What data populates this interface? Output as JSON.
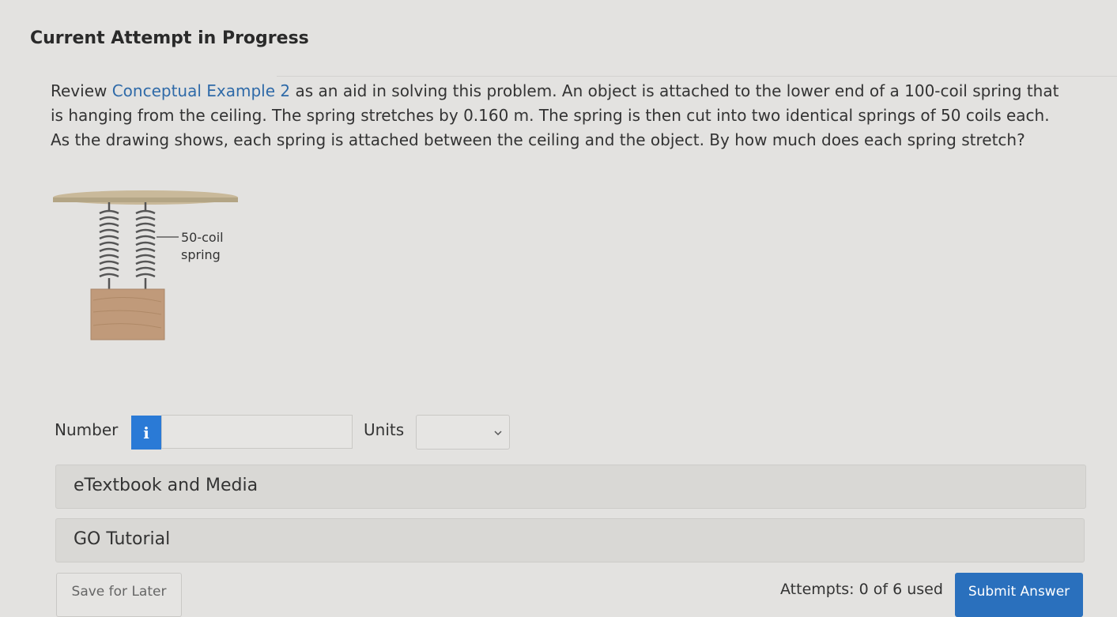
{
  "header": {
    "title": "Current Attempt in Progress"
  },
  "question": {
    "lead": "Review ",
    "link_text": "Conceptual Example 2",
    "text": " as an aid in solving this problem. An object is attached to the lower end of a 100-coil spring that is hanging from the ceiling. The spring stretches by 0.160 m. The spring is then cut into two identical springs of 50 coils each. As the drawing shows, each spring is attached between the ceiling and the object. By how much does each spring stretch?"
  },
  "figure": {
    "label_line1": "50-coil",
    "label_line2": "spring"
  },
  "answer": {
    "number_label": "Number",
    "info_icon_glyph": "i",
    "number_value": "",
    "units_label": "Units",
    "units_value": ""
  },
  "panels": {
    "etextbook_label": "eTextbook and Media",
    "go_tutorial_label": "GO Tutorial"
  },
  "footer": {
    "save_label": "Save for Later",
    "attempts_text": "Attempts: 0 of 6 used",
    "submit_label": "Submit Answer"
  },
  "colors": {
    "link": "#2f6aa8",
    "info_button": "#2a7ad6",
    "submit_button": "#2a70bd",
    "block": "#c09a7a",
    "ceiling": "#c9b99a"
  }
}
